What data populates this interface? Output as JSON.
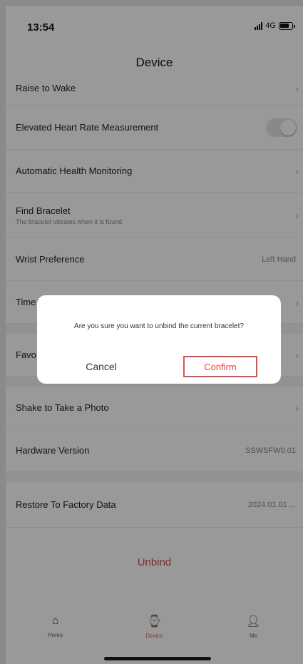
{
  "status_bar": {
    "time": "13:54",
    "network": "4G",
    "battery": "58"
  },
  "nav": {
    "title": "Device"
  },
  "settings": [
    {
      "label": "Raise to Wake",
      "control": "chevron"
    },
    {
      "label": "Elevated Heart Rate Measurement",
      "control": "toggle",
      "toggle_on": false
    },
    {
      "label": "Automatic Health Monitoring",
      "control": "chevron"
    },
    {
      "label": "Find Bracelet",
      "sublabel": "The bracelet vibrates when it is found",
      "control": "chevron"
    },
    {
      "label": "Wrist Preference",
      "value": "Left Hand",
      "control": "chevron"
    },
    {
      "label": "Time",
      "control": "chevron"
    },
    {
      "label": "Favo",
      "control": "chevron"
    },
    {
      "label": "Shake to Take a Photo",
      "control": "chevron"
    },
    {
      "label": "Hardware Version",
      "value": "SSWSFW0.01",
      "control": "chevron"
    },
    {
      "label": "Restore To Factory Data",
      "value": "2024.01.01 ...",
      "control": "chevron"
    }
  ],
  "unbind": {
    "label": "Unbind"
  },
  "tabs": [
    {
      "label": "Home",
      "icon": "home-icon",
      "active": false
    },
    {
      "label": "Device",
      "icon": "watch-icon",
      "active": true
    },
    {
      "label": "Me",
      "icon": "person-icon",
      "active": false
    }
  ],
  "dialog": {
    "message": "Are you sure you want to unbind the current bracelet?",
    "cancel_label": "Cancel",
    "confirm_label": "Confirm"
  },
  "colors": {
    "accent": "#e8453c",
    "highlight_border": "#e84a4a",
    "overlay": "rgba(0,0,0,0.4)"
  }
}
